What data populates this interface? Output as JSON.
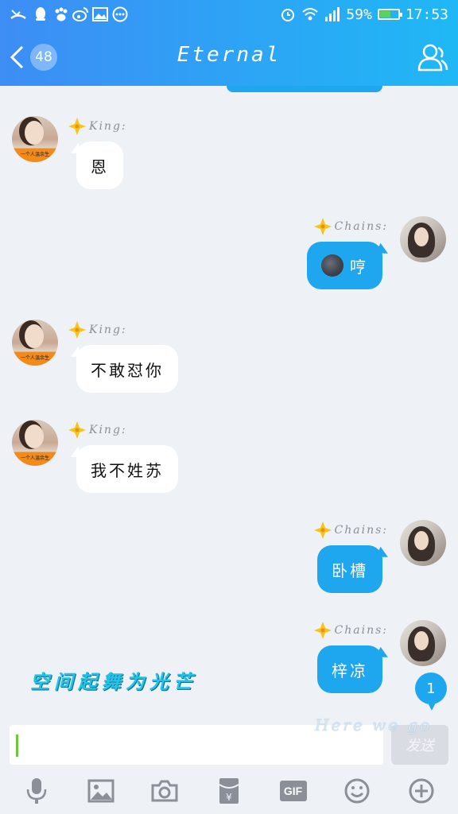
{
  "status_bar": {
    "icons_left": [
      "missed-call-icon",
      "qq-icon",
      "paw-icon",
      "weibo-icon",
      "gallery-icon",
      "more-dots-icon"
    ],
    "icons_right": [
      "alarm-icon",
      "wifi-icon",
      "signal-icon"
    ],
    "battery_percent": "59%",
    "battery_level": 0.59,
    "time": "17:53"
  },
  "nav": {
    "unread_count": "48",
    "title": "Eternal"
  },
  "messages": [
    {
      "side": "left",
      "sender": "King:",
      "text": "恩"
    },
    {
      "side": "right",
      "sender": "Chains:",
      "emoji": "new-moon-face",
      "text": "哼"
    },
    {
      "side": "left",
      "sender": "King:",
      "text": "不敢怼你"
    },
    {
      "side": "left",
      "sender": "King:",
      "text": "我不姓苏"
    },
    {
      "side": "right",
      "sender": "Chains:",
      "text": "卧槽"
    },
    {
      "side": "right",
      "sender": "Chains:",
      "text": "梓凉"
    }
  ],
  "avatar_caption": "一个人温余生",
  "decoration": {
    "overlay_text": "空间起舞为光芒",
    "float_badge": "1",
    "float_text": "Here we go"
  },
  "composer": {
    "input_value": "",
    "send_label": "发送"
  },
  "toolbar": [
    "microphone-icon",
    "image-icon",
    "camera-icon",
    "red-packet-icon",
    "gif-icon",
    "emoji-icon",
    "plus-icon"
  ],
  "toolbar_gif_label": "GIF",
  "colors": {
    "header_start": "#3d8df5",
    "header_end": "#1fb8f5",
    "bubble_mine": "#1ea6ef",
    "bubble_theirs": "#ffffff",
    "background": "#eef1f6"
  }
}
